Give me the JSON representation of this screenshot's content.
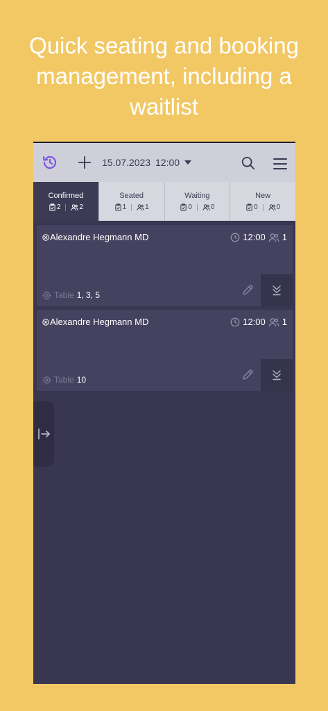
{
  "headline": "Quick seating and booking management, including a waitlist",
  "toolbar": {
    "date": "15.07.2023",
    "time": "12:00",
    "icons": [
      "history-icon",
      "plus-icon",
      "caret-down-icon",
      "search-icon",
      "hamburger-menu-icon"
    ]
  },
  "tabs": [
    {
      "label": "Confirmed",
      "bookings": "2",
      "guests": "2",
      "active": true
    },
    {
      "label": "Seated",
      "bookings": "1",
      "guests": "1",
      "active": false
    },
    {
      "label": "Waiting",
      "bookings": "0",
      "guests": "0",
      "active": false
    },
    {
      "label": "New",
      "bookings": "0",
      "guests": "0",
      "active": false
    }
  ],
  "reservations": [
    {
      "guest": "Alexandre Hegmann MD",
      "time": "12:00",
      "party": "1",
      "table_label": "Table",
      "tables": "1, 3, 5"
    },
    {
      "guest": "Alexandre Hegmann MD",
      "time": "12:00",
      "party": "1",
      "table_label": "Table",
      "tables": "10"
    }
  ],
  "colors": {
    "background": "#f2c865",
    "app_bg": "#393652",
    "card": "#45425f",
    "active_tab": "#3c3a55",
    "toolbar": "#cfcfd9",
    "accent": "#7b55e0"
  }
}
